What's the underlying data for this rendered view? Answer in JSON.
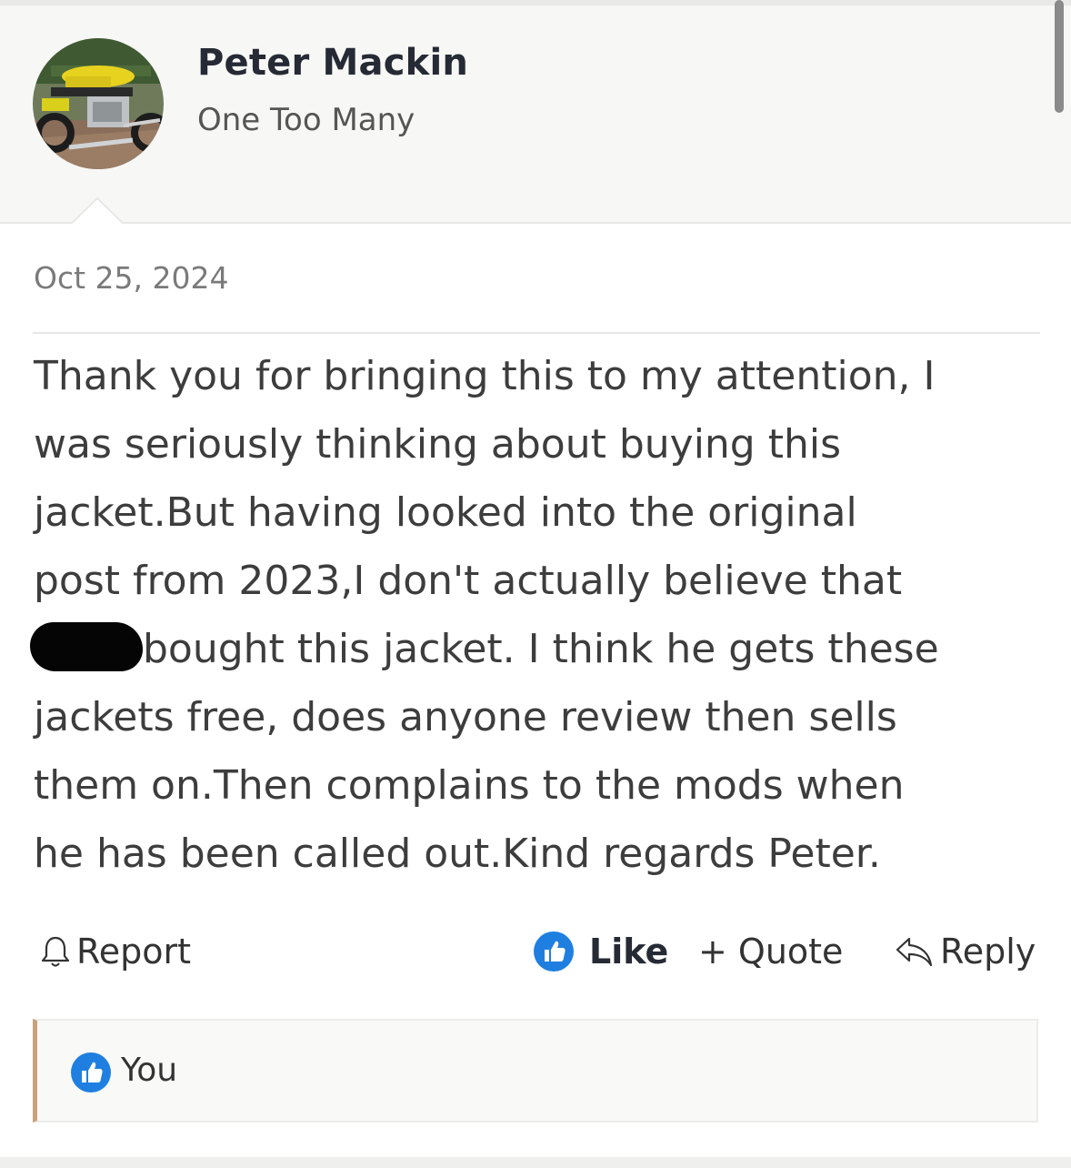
{
  "author": {
    "name": "Peter Mackin",
    "title": "One Too Many",
    "avatar_icon": "motorcycle-avatar"
  },
  "post": {
    "date": "Oct 25, 2024",
    "body_lines": [
      "Thank you for bringing this to my attention, I",
      "was seriously thinking about buying this",
      "jacket.But having looked into the original",
      "post from 2023,I don't actually believe that",
      "bought this jacket. I think he gets these",
      "jackets free, does anyone review then sells",
      "them on.Then complains to the mods when",
      "he has been called out.Kind regards Peter."
    ]
  },
  "actions": {
    "report": "Report",
    "like": "Like",
    "quote": "+ Quote",
    "reply": "Reply"
  },
  "reactions": {
    "user": "You",
    "icon": "thumbs-up-icon"
  },
  "colors": {
    "accent_blue": "#1f7fe0",
    "reaction_border": "#c9a27a",
    "name_color": "#252a35"
  }
}
